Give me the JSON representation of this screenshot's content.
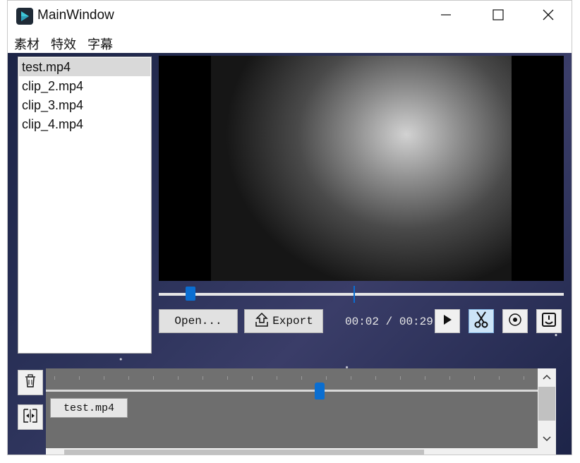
{
  "window": {
    "title": "MainWindow",
    "minimize_icon": "minimize-icon",
    "maximize_icon": "maximize-icon",
    "close_icon": "close-icon"
  },
  "menu": [
    "素材",
    "特效",
    "字幕"
  ],
  "files": [
    {
      "name": "test.mp4",
      "selected": true
    },
    {
      "name": "clip_2.mp4",
      "selected": false
    },
    {
      "name": "clip_3.mp4",
      "selected": false
    },
    {
      "name": "clip_4.mp4",
      "selected": false
    }
  ],
  "player": {
    "open_label": "Open...",
    "export_label": "Export",
    "current_time": "00:02",
    "separator": "/",
    "total_time": "00:29",
    "progress_fraction": 0.069,
    "controls": [
      "play-icon",
      "scissors-icon",
      "record-icon",
      "save-icon"
    ]
  },
  "timeline": {
    "clip_label": "test.mp4",
    "side_buttons": [
      "trash-icon",
      "split-icon"
    ]
  },
  "colors": {
    "accent": "#0a6ed1",
    "timeline_bg": "#6e6e6e"
  }
}
